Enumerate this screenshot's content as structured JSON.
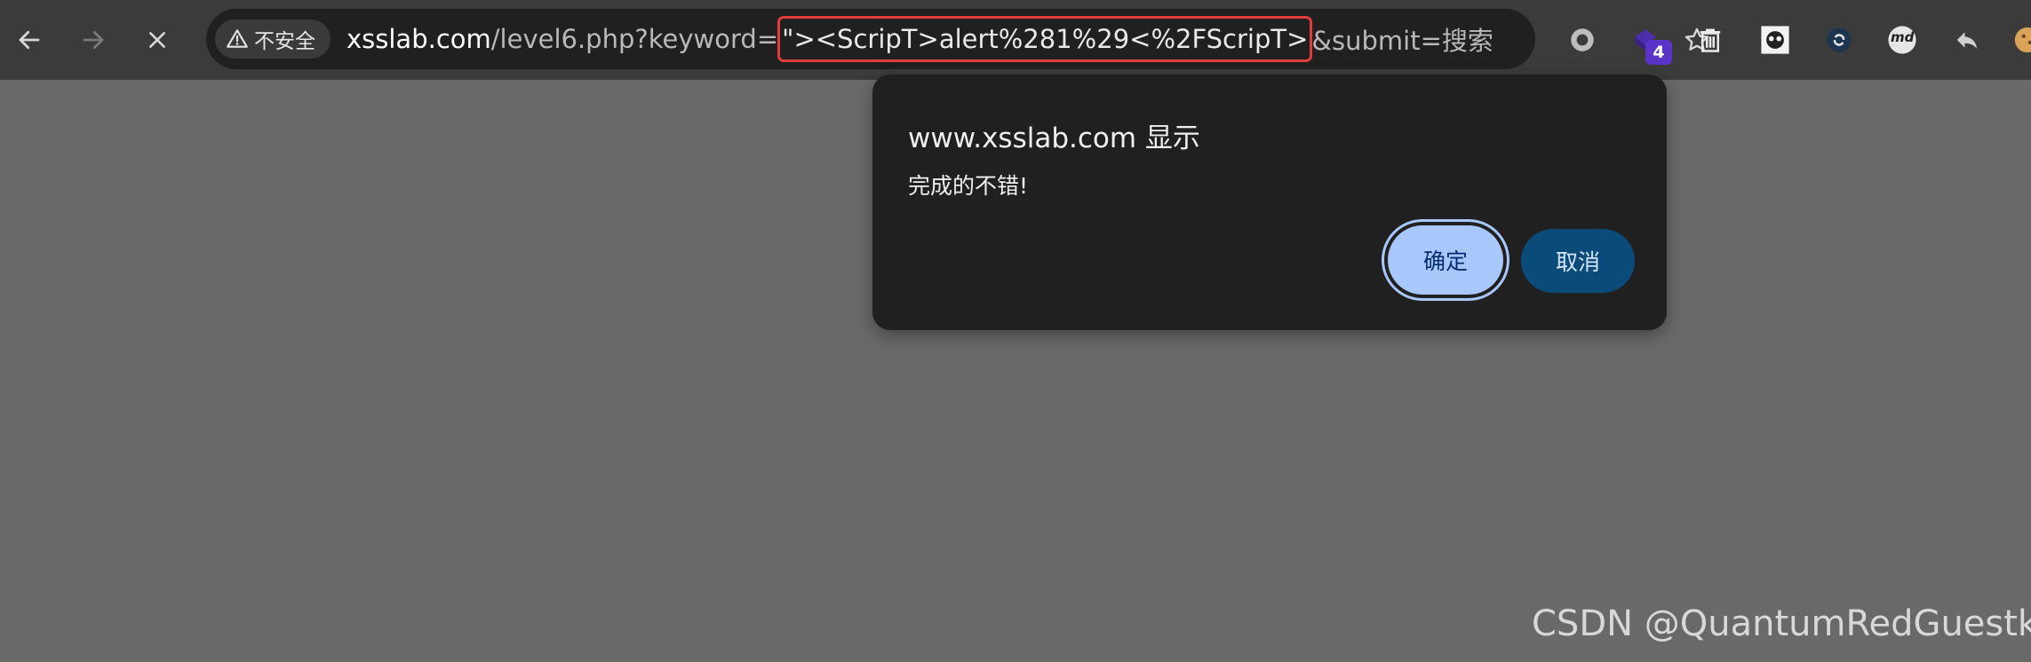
{
  "browser": {
    "nav": {
      "back_icon": "back-arrow-icon",
      "forward_icon": "forward-arrow-icon",
      "stop_icon": "stop-loading-icon"
    },
    "omnibox": {
      "security_label": "不安全",
      "security_icon": "warning-triangle-icon",
      "url_prefix_host": "xsslab.com",
      "url_prefix_path": "/level6.php?keyword=",
      "url_highlight": "\"><ScripT>alert%281%29<%2FScripT>",
      "url_suffix": "&submit=搜索",
      "highlight_color": "#e03c3c",
      "bookmark_icon": "star-icon"
    },
    "extensions": [
      {
        "icon": "circle-record-icon"
      },
      {
        "icon": "puzzle-extension-icon",
        "badge": "4"
      },
      {
        "icon": "trash-can-icon"
      },
      {
        "icon": "panda-extension-icon"
      },
      {
        "icon": "refresh-circle-icon"
      },
      {
        "icon": "md-icon",
        "label": "md"
      },
      {
        "icon": "reply-arrow-icon"
      },
      {
        "icon": "cookie-icon"
      }
    ]
  },
  "dialog": {
    "title": "www.xsslab.com 显示",
    "message": "完成的不错!",
    "ok_label": "确定",
    "cancel_label": "取消",
    "ok_color": "#a8c7fa",
    "cancel_color": "#0b4b7a"
  },
  "page": {
    "background": "#696969",
    "watermark": "CSDN @QuantumRedGuestk"
  }
}
